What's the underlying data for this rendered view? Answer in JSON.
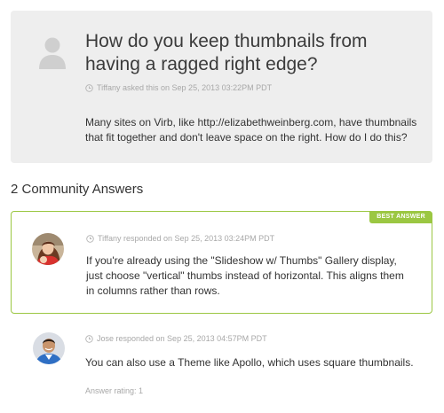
{
  "question": {
    "title": "How do you keep thumbnails from having a ragged right edge?",
    "meta": "Tiffany asked this on Sep 25, 2013 03:22PM PDT",
    "body": "Many sites on Virb, like http://elizabethweinberg.com, have thumbnails that fit together and don't leave space on the right. How do I do this?"
  },
  "answers_heading": "2 Community Answers",
  "answers": [
    {
      "badge": "BEST ANSWER",
      "meta": "Tiffany responded on Sep 25, 2013 03:24PM PDT",
      "text": "If you're already using the \"Slideshow w/ Thumbs\" Gallery display, just choose \"vertical\" thumbs instead of horizontal. This aligns them in columns rather than rows."
    },
    {
      "meta": "Jose responded on Sep 25, 2013 04:57PM PDT",
      "text": "You can also use a Theme like Apollo, which uses square thumbnails.",
      "rating": "Answer rating: 1"
    }
  ],
  "colors": {
    "accent_green": "#9bc742",
    "meta_gray": "#a8a8a8",
    "card_bg": "#eeeeee"
  },
  "icons": [
    "default-user-avatar-icon",
    "clock-icon"
  ]
}
